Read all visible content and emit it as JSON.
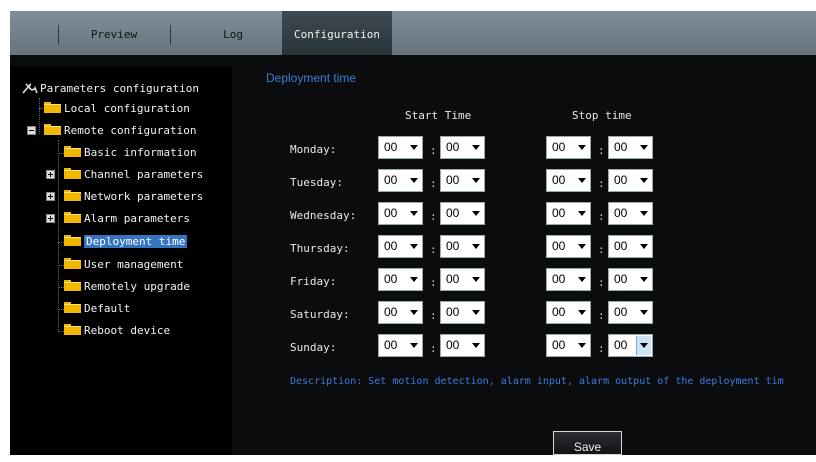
{
  "tabs": [
    {
      "label": "Preview"
    },
    {
      "label": "Log"
    },
    {
      "label": "Configuration",
      "active": true
    }
  ],
  "sidebar": {
    "root": "Parameters configuration",
    "items": [
      {
        "label": "Local configuration"
      },
      {
        "label": "Remote configuration",
        "expanded": true
      },
      {
        "label": "Basic information"
      },
      {
        "label": "Channel parameters",
        "collapsed": true
      },
      {
        "label": "Network parameters",
        "collapsed": true
      },
      {
        "label": "Alarm parameters",
        "collapsed": true
      },
      {
        "label": "Deployment time",
        "selected": true
      },
      {
        "label": "User management"
      },
      {
        "label": "Remotely upgrade"
      },
      {
        "label": "Default"
      },
      {
        "label": "Reboot device"
      }
    ]
  },
  "main": {
    "title": "Deployment time",
    "start_header": "Start Time",
    "stop_header": "Stop time",
    "separator": ":",
    "rows": [
      {
        "day": "Monday:",
        "start_h": "00",
        "start_m": "00",
        "stop_h": "00",
        "stop_m": "00"
      },
      {
        "day": "Tuesday:",
        "start_h": "00",
        "start_m": "00",
        "stop_h": "00",
        "stop_m": "00"
      },
      {
        "day": "Wednesday:",
        "start_h": "00",
        "start_m": "00",
        "stop_h": "00",
        "stop_m": "00"
      },
      {
        "day": "Thursday:",
        "start_h": "00",
        "start_m": "00",
        "stop_h": "00",
        "stop_m": "00"
      },
      {
        "day": "Friday:",
        "start_h": "00",
        "start_m": "00",
        "stop_h": "00",
        "stop_m": "00"
      },
      {
        "day": "Saturday:",
        "start_h": "00",
        "start_m": "00",
        "stop_h": "00",
        "stop_m": "00"
      },
      {
        "day": "Sunday:",
        "start_h": "00",
        "start_m": "00",
        "stop_h": "00",
        "stop_m": "00"
      }
    ],
    "description": "Description: Set motion detection, alarm input, alarm output of the deployment tim",
    "save_label": "Save"
  },
  "colors": {
    "accent_blue": "#3f7cd6",
    "selected_bg": "#3674c2",
    "folder": "#f2b800"
  }
}
